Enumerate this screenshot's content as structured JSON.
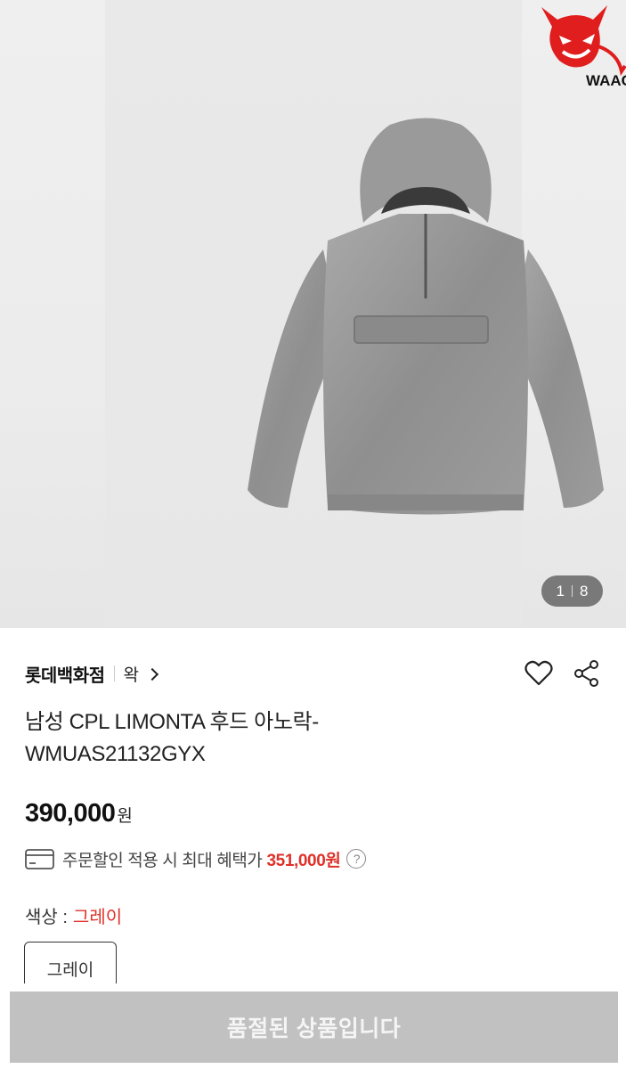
{
  "gallery": {
    "current_page": "1",
    "total_pages": "8",
    "logo_text": "WAAC"
  },
  "store": {
    "name": "롯데백화점",
    "brand_link": "왁"
  },
  "product": {
    "title": "남성 CPL LIMONTA 후드 아노락-WMUAS21132GYX",
    "price": "390,000",
    "price_unit": "원"
  },
  "benefit": {
    "text": "주문할인 적용 시 최대 혜택가",
    "price": "351,000원"
  },
  "option": {
    "label": "색상 :",
    "selected": "그레이",
    "chip": "그레이"
  },
  "cta": {
    "label": "품절된 상품입니다"
  },
  "colors": {
    "accent_red": "#e0312a",
    "disabled_button": "#c1c1c1",
    "counter_bg": "#5a5a5a"
  },
  "icons": [
    "heart-icon",
    "share-icon",
    "card-icon",
    "help-icon",
    "chevron-right-icon"
  ]
}
